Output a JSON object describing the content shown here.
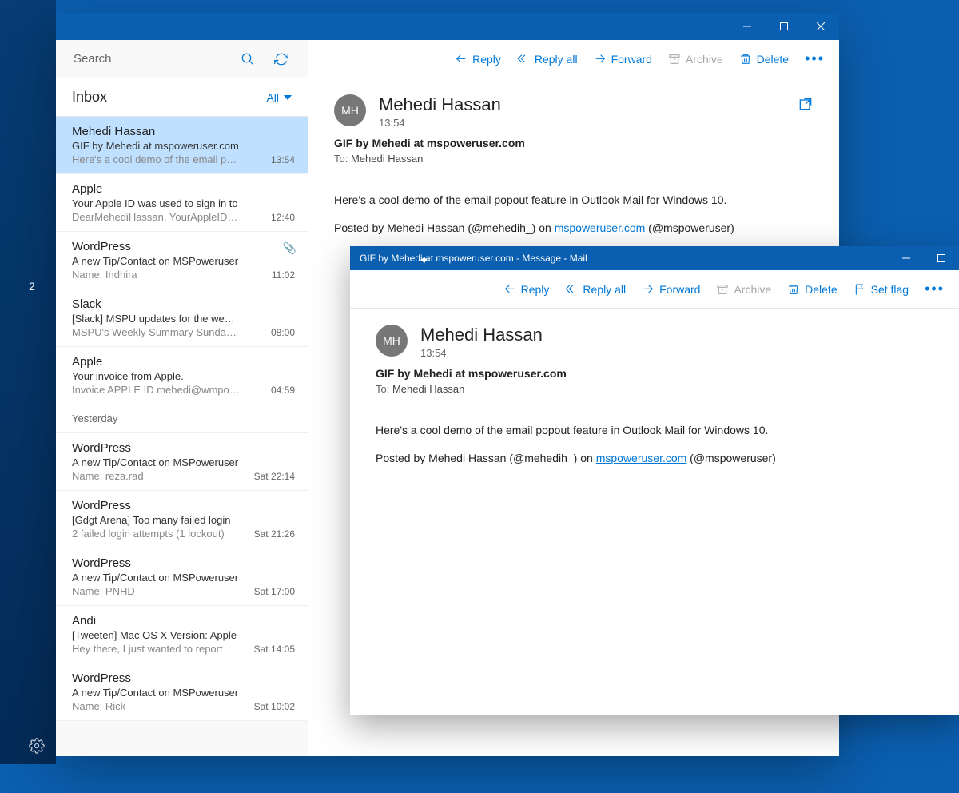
{
  "accent_color": "#0078d7",
  "titlebar_color": "#0b5fb0",
  "desk": {
    "badge": "2"
  },
  "search": {
    "placeholder": "Search"
  },
  "folder": {
    "title": "Inbox",
    "filter": "All"
  },
  "groups": {
    "yesterday": "Yesterday"
  },
  "items": [
    {
      "sender": "Mehedi Hassan",
      "subject": "GIF by Mehedi at mspoweruser.com",
      "preview": "Here's a cool demo of the email popout",
      "time": "13:54",
      "selected": true,
      "attach": false
    },
    {
      "sender": "Apple",
      "subject": "Your Apple ID was used to sign in to",
      "preview": "DearMehediHassan, YourAppleID(mehedi",
      "time": "12:40",
      "selected": false,
      "attach": false
    },
    {
      "sender": "WordPress",
      "subject": "A new Tip/Contact on MSPoweruser",
      "preview": "Name: Indhira <inireader@gmail.com>",
      "time": "11:02",
      "selected": false,
      "attach": true
    },
    {
      "sender": "Slack",
      "subject": "[Slack] MSPU updates for the week of",
      "preview": "MSPU's Weekly Summary Sunday, May",
      "time": "08:00",
      "selected": false,
      "attach": false
    },
    {
      "sender": "Apple",
      "subject": "Your invoice from Apple.",
      "preview": "Invoice APPLE ID mehedi@wmpoweruser",
      "time": "04:59",
      "selected": false,
      "attach": false
    },
    {
      "sender": "WordPress",
      "subject": "A new Tip/Contact on MSPoweruser",
      "preview": "Name: reza.rad <reza.rad@windows",
      "time": "Sat 22:14",
      "selected": false,
      "attach": false
    },
    {
      "sender": "WordPress",
      "subject": "[Gdgt Arena] Too many failed login",
      "preview": "2 failed login attempts (1 lockout)",
      "time": "Sat 21:26",
      "selected": false,
      "attach": false
    },
    {
      "sender": "WordPress",
      "subject": "A new Tip/Contact on MSPoweruser",
      "preview": "Name: PNHD <saram@yahoo.com>",
      "time": "Sat 17:00",
      "selected": false,
      "attach": false
    },
    {
      "sender": "Andi",
      "subject": "[Tweeten] Mac OS X Version: Apple",
      "preview": "Hey there, I just wanted to report",
      "time": "Sat 14:05",
      "selected": false,
      "attach": false
    },
    {
      "sender": "WordPress",
      "subject": "A new Tip/Contact on MSPoweruser",
      "preview": "Name: Rick <r.siegenthaler@outlook",
      "time": "Sat 10:02",
      "selected": false,
      "attach": false
    }
  ],
  "toolbar": {
    "reply": "Reply",
    "reply_all": "Reply all",
    "forward": "Forward",
    "archive": "Archive",
    "delete": "Delete",
    "set_flag": "Set flag"
  },
  "message": {
    "avatar": "MH",
    "sender": "Mehedi Hassan",
    "time": "13:54",
    "subject": "GIF by Mehedi at mspoweruser.com",
    "to_label": "To:",
    "to_value": "Mehedi Hassan",
    "body_line1": "Here's a cool demo of the email popout feature in Outlook Mail for Windows 10.",
    "body_line2_pre": "Posted by Mehedi Hassan (@mehedih_) on ",
    "body_link": "mspoweruser.com",
    "body_line2_post": " (@mspoweruser)"
  },
  "popup": {
    "title": "GIF by Mehedi at mspoweruser.com - Message - Mail"
  }
}
